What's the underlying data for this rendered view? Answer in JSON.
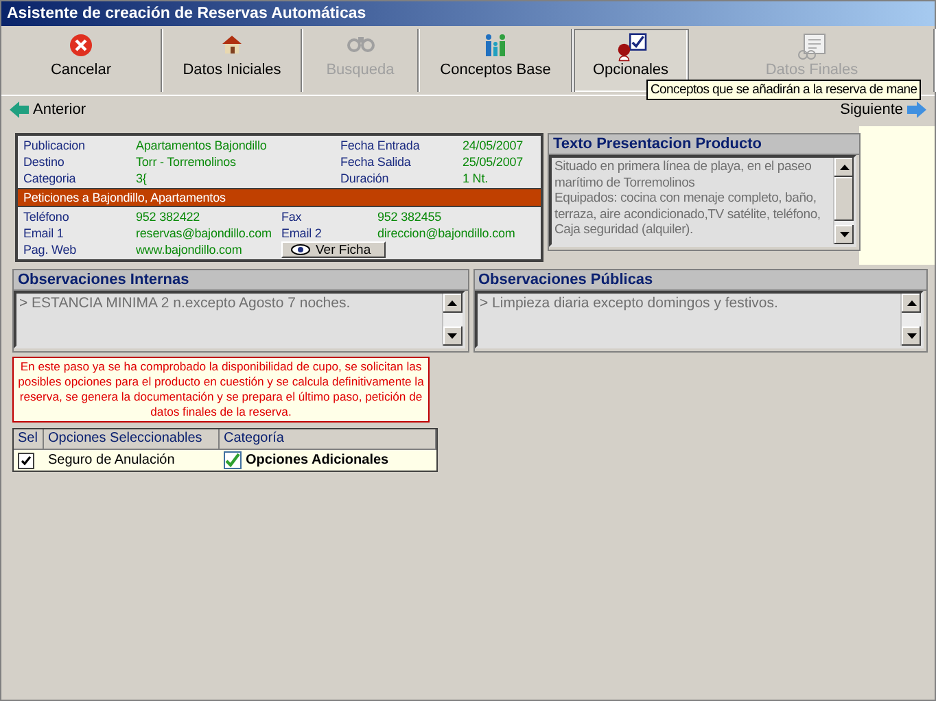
{
  "window": {
    "title": "Asistente de creación de Reservas Automáticas"
  },
  "toolbar": [
    {
      "label": "Cancelar",
      "kind": "cancel",
      "selected": false,
      "disabled": false
    },
    {
      "label": "Datos Iniciales",
      "kind": "house",
      "selected": false,
      "disabled": false
    },
    {
      "label": "Busqueda",
      "kind": "binoculars",
      "selected": false,
      "disabled": true
    },
    {
      "label": "Conceptos Base",
      "kind": "people",
      "selected": false,
      "disabled": false
    },
    {
      "label": "Opcionales",
      "kind": "options",
      "selected": true,
      "disabled": false
    },
    {
      "label": "Datos Finales",
      "kind": "document",
      "selected": false,
      "disabled": true
    }
  ],
  "tooltip": "Conceptos que se añadirán a la reserva de mane",
  "nav": {
    "back": "Anterior",
    "next": "Siguiente"
  },
  "product": {
    "fields": [
      {
        "label": "Publicacion",
        "value": "Apartamentos Bajondillo"
      },
      {
        "label": "Fecha Entrada",
        "value": "24/05/2007"
      },
      {
        "label": "Destino",
        "value": "Torr - Torremolinos"
      },
      {
        "label": "Fecha Salida",
        "value": "25/05/2007"
      },
      {
        "label": "Categoria",
        "value": "3{"
      },
      {
        "label": "Duración",
        "value": "1 Nt."
      }
    ],
    "banner": "Peticiones a Bajondillo, Apartamentos",
    "contacts": [
      {
        "label": "Teléfono",
        "value": "952 382422"
      },
      {
        "label": "Fax",
        "value": "952 382455"
      },
      {
        "label": "Email 1",
        "value": "reservas@bajondillo.com"
      },
      {
        "label": "Email 2",
        "value": "direccion@bajondillo.com"
      },
      {
        "label": "Pag. Web",
        "value": "www.bajondillo.com"
      }
    ],
    "button": "Ver Ficha"
  },
  "presentation": {
    "title": "Texto Presentacion Producto",
    "lines": [
      "Situado en primera línea de playa, en el paseo marítimo de Torremolinos",
      "Equipados: cocina con menaje completo, baño, terraza, aire acondicionado,TV satélite,  teléfono, Caja seguridad (alquiler)."
    ]
  },
  "observations": [
    {
      "title": "Observaciones Internas",
      "text": "> ESTANCIA MINIMA 2 n.excepto Agosto 7 noches."
    },
    {
      "title": "Observaciones Públicas",
      "text": "> Limpieza diaria excepto domingos y festivos."
    }
  ],
  "note": "En este paso ya se ha comprobado la disponibilidad de cupo, se solicitan las posibles opciones para el producto en cuestión y se calcula definitivamente la reserva, se genera la documentación y se prepara el último paso, petición de datos finales de la reserva.",
  "options": {
    "columns": [
      "Sel",
      "Opciones Seleccionables",
      "Categoría"
    ],
    "rows": [
      {
        "checked": true,
        "name": "Seguro de Anulación",
        "category_checked": true,
        "category": "Opciones Adicionales"
      }
    ]
  }
}
